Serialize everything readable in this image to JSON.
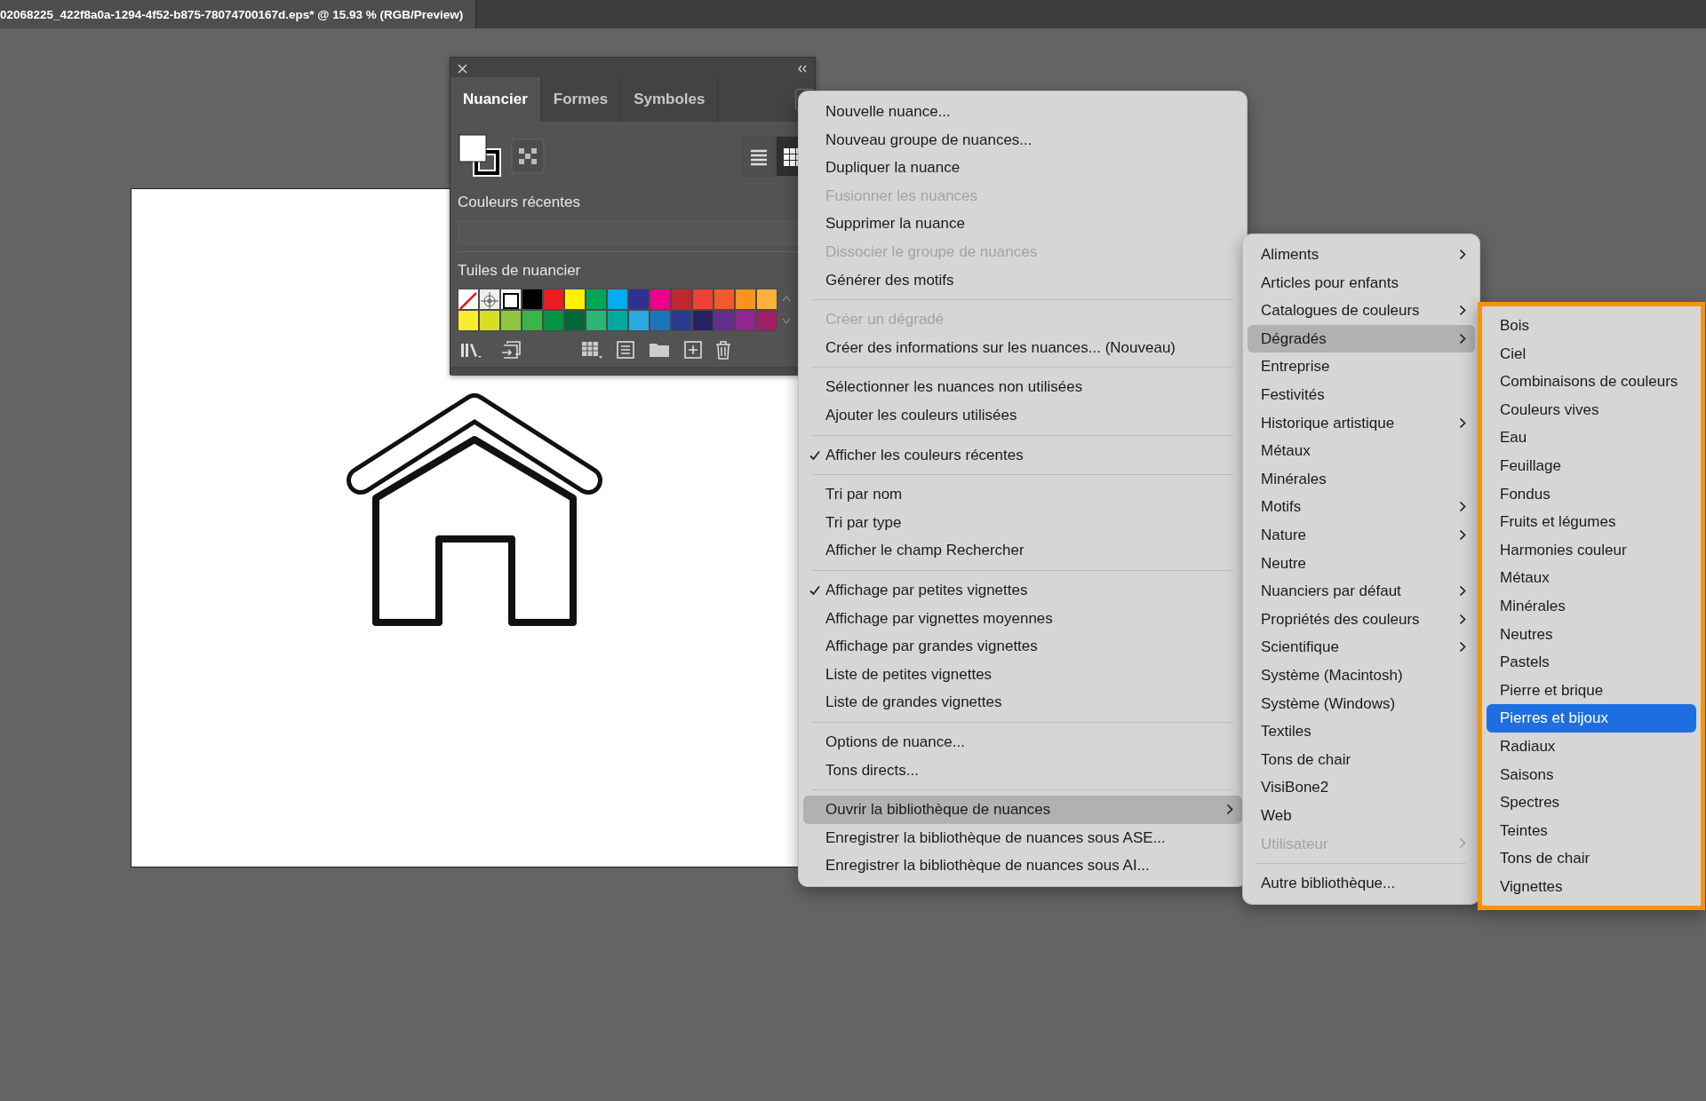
{
  "document_tab": {
    "title": "02068225_422f8a0a-1294-4f52-b875-78074700167d.eps* @ 15.93 % (RGB/Preview)"
  },
  "panel": {
    "tabs": [
      {
        "label": "Nuancier",
        "selected": true
      },
      {
        "label": "Formes",
        "selected": false
      },
      {
        "label": "Symboles",
        "selected": false
      }
    ],
    "views": [
      {
        "kind": "list",
        "selected": false
      },
      {
        "kind": "grid",
        "selected": true
      }
    ],
    "recent_label": "Couleurs récentes",
    "tiles_label": "Tuiles de nuancier",
    "swatches": [
      {
        "kind": "none"
      },
      {
        "kind": "registration"
      },
      {
        "kind": "white"
      },
      {
        "kind": "color",
        "color": "#000000"
      },
      {
        "kind": "color",
        "color": "#ed1c24"
      },
      {
        "kind": "color",
        "color": "#fff200"
      },
      {
        "kind": "color",
        "color": "#00a651"
      },
      {
        "kind": "color",
        "color": "#00aeef"
      },
      {
        "kind": "color",
        "color": "#2e3192"
      },
      {
        "kind": "color",
        "color": "#ec008c"
      },
      {
        "kind": "color",
        "color": "#c1272d"
      },
      {
        "kind": "color",
        "color": "#ef4136"
      },
      {
        "kind": "color",
        "color": "#f15a29"
      },
      {
        "kind": "color",
        "color": "#f7941d"
      },
      {
        "kind": "color",
        "color": "#fbb040"
      },
      {
        "kind": "color",
        "color": "#f9ed32"
      },
      {
        "kind": "color",
        "color": "#d7df23"
      },
      {
        "kind": "color",
        "color": "#8dc63f"
      },
      {
        "kind": "color",
        "color": "#39b54a"
      },
      {
        "kind": "color",
        "color": "#009444"
      },
      {
        "kind": "color",
        "color": "#006838"
      },
      {
        "kind": "color",
        "color": "#2bb673"
      },
      {
        "kind": "color",
        "color": "#00a99d"
      },
      {
        "kind": "color",
        "color": "#27aae1"
      },
      {
        "kind": "color",
        "color": "#1c75bc"
      },
      {
        "kind": "color",
        "color": "#2b3990"
      },
      {
        "kind": "color",
        "color": "#262262"
      },
      {
        "kind": "color",
        "color": "#662d91"
      },
      {
        "kind": "color",
        "color": "#92278f"
      },
      {
        "kind": "color",
        "color": "#9e1f63"
      }
    ]
  },
  "menu": {
    "groups": [
      {
        "items": [
          {
            "label": "Nouvelle nuance...",
            "checked": false,
            "disabled": false,
            "selected": false,
            "submenu": false
          },
          {
            "label": "Nouveau groupe de nuances...",
            "checked": false,
            "disabled": false,
            "selected": false,
            "submenu": false
          },
          {
            "label": "Dupliquer la nuance",
            "checked": false,
            "disabled": false,
            "selected": false,
            "submenu": false
          },
          {
            "label": "Fusionner les nuances",
            "checked": false,
            "disabled": true,
            "selected": false,
            "submenu": false
          },
          {
            "label": "Supprimer la nuance",
            "checked": false,
            "disabled": false,
            "selected": false,
            "submenu": false
          },
          {
            "label": "Dissocier le groupe de nuances",
            "checked": false,
            "disabled": true,
            "selected": false,
            "submenu": false
          },
          {
            "label": "Générer des motifs",
            "checked": false,
            "disabled": false,
            "selected": false,
            "submenu": false
          }
        ]
      },
      {
        "items": [
          {
            "label": "Créer un dégradé",
            "checked": false,
            "disabled": true,
            "selected": false,
            "submenu": false
          },
          {
            "label": "Créer des informations sur les nuances... (Nouveau)",
            "checked": false,
            "disabled": false,
            "selected": false,
            "submenu": false
          }
        ]
      },
      {
        "items": [
          {
            "label": "Sélectionner les nuances non utilisées",
            "checked": false,
            "disabled": false,
            "selected": false,
            "submenu": false
          },
          {
            "label": "Ajouter les couleurs utilisées",
            "checked": false,
            "disabled": false,
            "selected": false,
            "submenu": false
          }
        ]
      },
      {
        "items": [
          {
            "label": "Afficher les couleurs récentes",
            "checked": true,
            "disabled": false,
            "selected": false,
            "submenu": false
          }
        ]
      },
      {
        "items": [
          {
            "label": "Tri par nom",
            "checked": false,
            "disabled": false,
            "selected": false,
            "submenu": false
          },
          {
            "label": "Tri par type",
            "checked": false,
            "disabled": false,
            "selected": false,
            "submenu": false
          },
          {
            "label": "Afficher le champ Rechercher",
            "checked": false,
            "disabled": false,
            "selected": false,
            "submenu": false
          }
        ]
      },
      {
        "items": [
          {
            "label": "Affichage par petites vignettes",
            "checked": true,
            "disabled": false,
            "selected": false,
            "submenu": false
          },
          {
            "label": "Affichage par vignettes moyennes",
            "checked": false,
            "disabled": false,
            "selected": false,
            "submenu": false
          },
          {
            "label": "Affichage par grandes vignettes",
            "checked": false,
            "disabled": false,
            "selected": false,
            "submenu": false
          },
          {
            "label": "Liste de petites vignettes",
            "checked": false,
            "disabled": false,
            "selected": false,
            "submenu": false
          },
          {
            "label": "Liste de grandes vignettes",
            "checked": false,
            "disabled": false,
            "selected": false,
            "submenu": false
          }
        ]
      },
      {
        "items": [
          {
            "label": "Options de nuance...",
            "checked": false,
            "disabled": false,
            "selected": false,
            "submenu": false
          },
          {
            "label": "Tons directs...",
            "checked": false,
            "disabled": false,
            "selected": false,
            "submenu": false
          }
        ]
      },
      {
        "items": [
          {
            "label": "Ouvrir la bibliothèque de nuances",
            "checked": false,
            "disabled": false,
            "selected": true,
            "submenu": true
          },
          {
            "label": "Enregistrer la bibliothèque de nuances sous ASE...",
            "checked": false,
            "disabled": false,
            "selected": false,
            "submenu": false
          },
          {
            "label": "Enregistrer la bibliothèque de nuances sous AI...",
            "checked": false,
            "disabled": false,
            "selected": false,
            "submenu": false
          }
        ]
      }
    ]
  },
  "library_menu": {
    "groups": [
      {
        "items": [
          {
            "label": "Aliments",
            "disabled": false,
            "selected": false,
            "submenu": true
          },
          {
            "label": "Articles pour enfants",
            "disabled": false,
            "selected": false,
            "submenu": false
          },
          {
            "label": "Catalogues de couleurs",
            "disabled": false,
            "selected": false,
            "submenu": true
          },
          {
            "label": "Dégradés",
            "disabled": false,
            "selected": true,
            "submenu": true
          },
          {
            "label": "Entreprise",
            "disabled": false,
            "selected": false,
            "submenu": false
          },
          {
            "label": "Festivités",
            "disabled": false,
            "selected": false,
            "submenu": false
          },
          {
            "label": "Historique artistique",
            "disabled": false,
            "selected": false,
            "submenu": true
          },
          {
            "label": "Métaux",
            "disabled": false,
            "selected": false,
            "submenu": false
          },
          {
            "label": "Minérales",
            "disabled": false,
            "selected": false,
            "submenu": false
          },
          {
            "label": "Motifs",
            "disabled": false,
            "selected": false,
            "submenu": true
          },
          {
            "label": "Nature",
            "disabled": false,
            "selected": false,
            "submenu": true
          },
          {
            "label": "Neutre",
            "disabled": false,
            "selected": false,
            "submenu": false
          },
          {
            "label": "Nuanciers par défaut",
            "disabled": false,
            "selected": false,
            "submenu": true
          },
          {
            "label": "Propriétés des couleurs",
            "disabled": false,
            "selected": false,
            "submenu": true
          },
          {
            "label": "Scientifique",
            "disabled": false,
            "selected": false,
            "submenu": true
          },
          {
            "label": "Système (Macintosh)",
            "disabled": false,
            "selected": false,
            "submenu": false
          },
          {
            "label": "Système (Windows)",
            "disabled": false,
            "selected": false,
            "submenu": false
          },
          {
            "label": "Textiles",
            "disabled": false,
            "selected": false,
            "submenu": false
          },
          {
            "label": "Tons de chair",
            "disabled": false,
            "selected": false,
            "submenu": false
          },
          {
            "label": "VisiBone2",
            "disabled": false,
            "selected": false,
            "submenu": false
          },
          {
            "label": "Web",
            "disabled": false,
            "selected": false,
            "submenu": false
          },
          {
            "label": "Utilisateur",
            "disabled": true,
            "selected": false,
            "submenu": true
          }
        ]
      },
      {
        "items": [
          {
            "label": "Autre bibliothèque...",
            "disabled": false,
            "selected": false,
            "submenu": false
          }
        ]
      }
    ]
  },
  "gradient_menu": {
    "highlight_frame": true,
    "items": [
      {
        "label": "Bois",
        "selected": false
      },
      {
        "label": "Ciel",
        "selected": false
      },
      {
        "label": "Combinaisons de couleurs",
        "selected": false
      },
      {
        "label": "Couleurs vives",
        "selected": false
      },
      {
        "label": "Eau",
        "selected": false
      },
      {
        "label": "Feuillage",
        "selected": false
      },
      {
        "label": "Fondus",
        "selected": false
      },
      {
        "label": "Fruits et légumes",
        "selected": false
      },
      {
        "label": "Harmonies couleur",
        "selected": false
      },
      {
        "label": "Métaux",
        "selected": false
      },
      {
        "label": "Minérales",
        "selected": false
      },
      {
        "label": "Neutres",
        "selected": false
      },
      {
        "label": "Pastels",
        "selected": false
      },
      {
        "label": "Pierre et brique",
        "selected": false
      },
      {
        "label": "Pierres et bijoux",
        "selected": true
      },
      {
        "label": "Radiaux",
        "selected": false
      },
      {
        "label": "Saisons",
        "selected": false
      },
      {
        "label": "Spectres",
        "selected": false
      },
      {
        "label": "Teintes",
        "selected": false
      },
      {
        "label": "Tons de chair",
        "selected": false
      },
      {
        "label": "Vignettes",
        "selected": false
      }
    ]
  }
}
